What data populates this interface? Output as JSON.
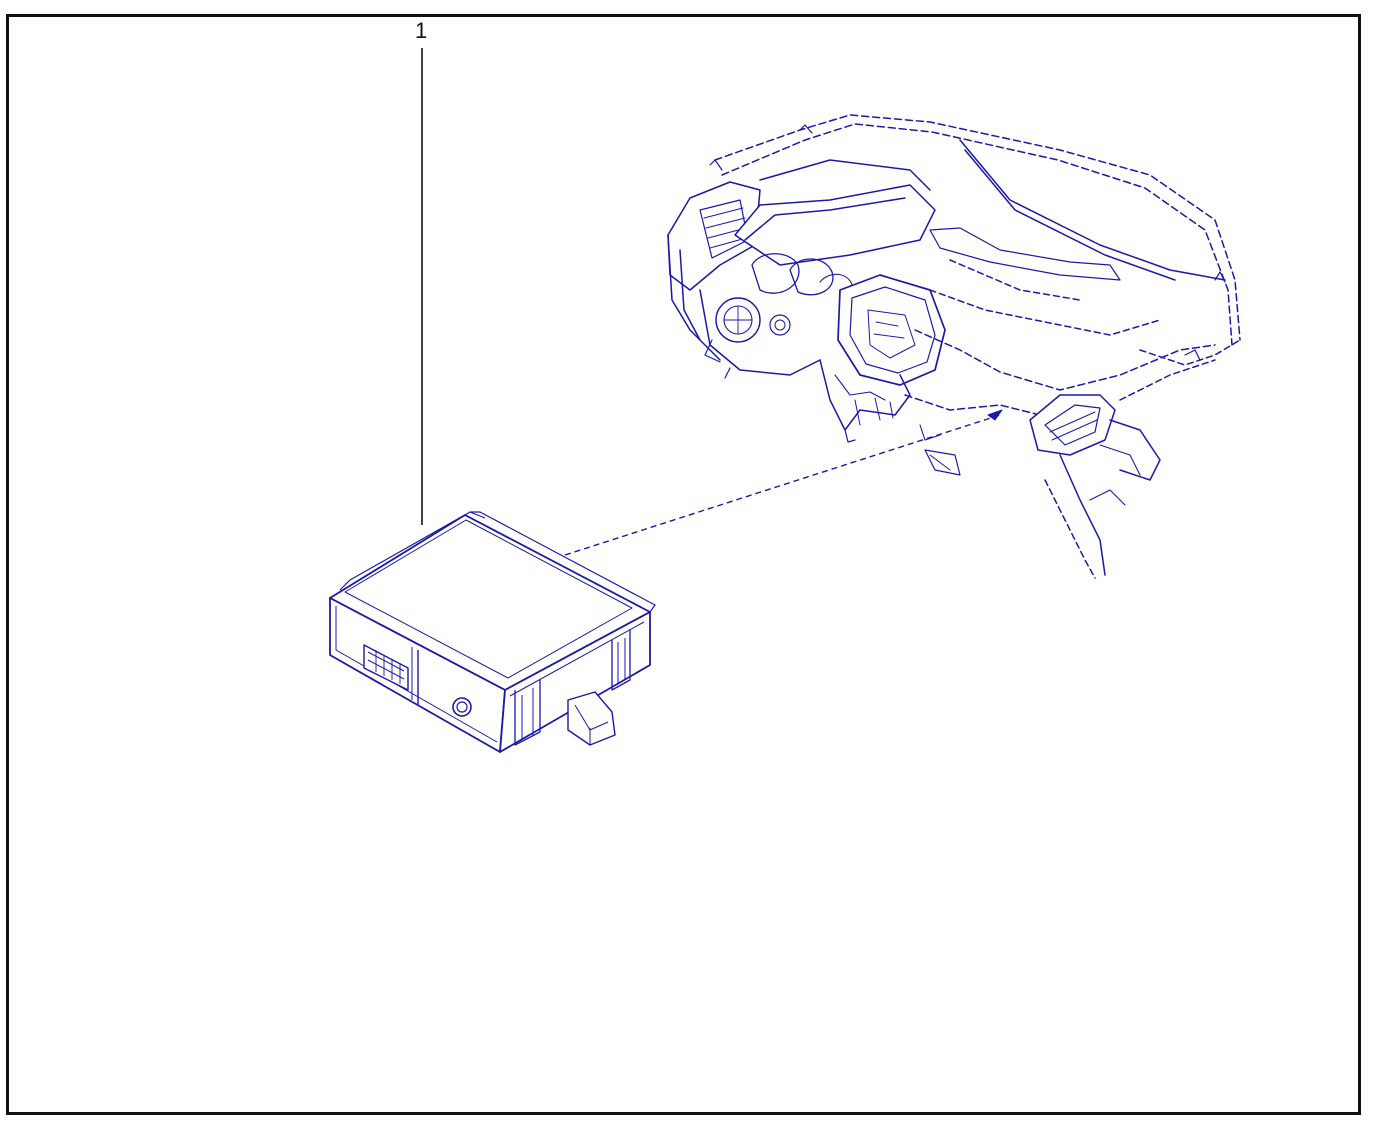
{
  "callout": {
    "number": "1"
  },
  "colors": {
    "line_art": "#1a1aa8",
    "frame": "#111111",
    "leader": "#111111"
  },
  "parts": [
    {
      "id": "1",
      "name": "control-unit"
    },
    {
      "name": "dashboard-assembly"
    }
  ]
}
